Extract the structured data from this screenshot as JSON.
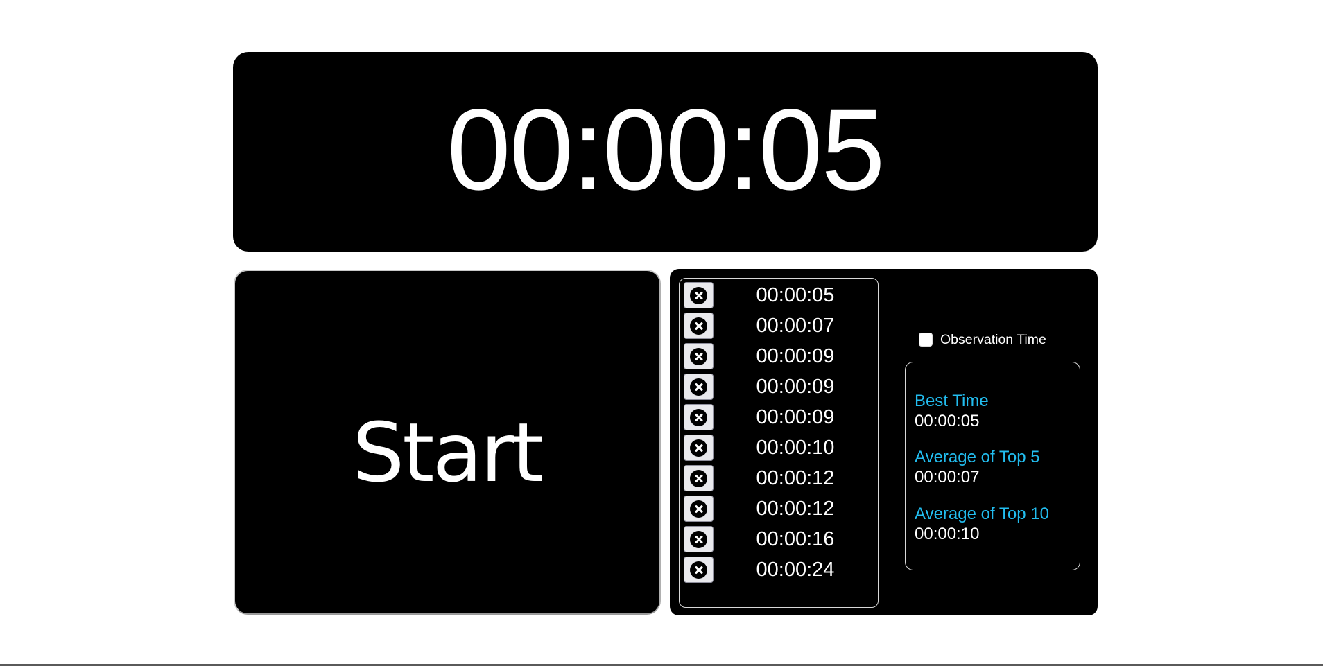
{
  "timer": {
    "display": "00:00:05"
  },
  "start_button": {
    "label": "Start"
  },
  "times_list": {
    "items": [
      {
        "time": "00:00:05",
        "delete_icon": "close-circle-icon"
      },
      {
        "time": "00:00:07",
        "delete_icon": "close-circle-icon"
      },
      {
        "time": "00:00:09",
        "delete_icon": "close-circle-icon"
      },
      {
        "time": "00:00:09",
        "delete_icon": "close-circle-icon"
      },
      {
        "time": "00:00:09",
        "delete_icon": "close-circle-icon"
      },
      {
        "time": "00:00:10",
        "delete_icon": "close-circle-icon"
      },
      {
        "time": "00:00:12",
        "delete_icon": "close-circle-icon"
      },
      {
        "time": "00:00:12",
        "delete_icon": "close-circle-icon"
      },
      {
        "time": "00:00:16",
        "delete_icon": "close-circle-icon"
      },
      {
        "time": "00:00:24",
        "delete_icon": "close-circle-icon"
      }
    ]
  },
  "observation": {
    "label": "Observation Time",
    "checked": false
  },
  "stats": {
    "best_time": {
      "label": "Best Time",
      "value": "00:00:05"
    },
    "avg_top5": {
      "label": "Average of Top 5",
      "value": "00:00:07"
    },
    "avg_top10": {
      "label": "Average of Top 10",
      "value": "00:00:10"
    }
  },
  "colors": {
    "panel_bg": "#000000",
    "text": "#ffffff",
    "stat_heading": "#22bdef",
    "delete_button_bg": "#e9e9ed"
  }
}
